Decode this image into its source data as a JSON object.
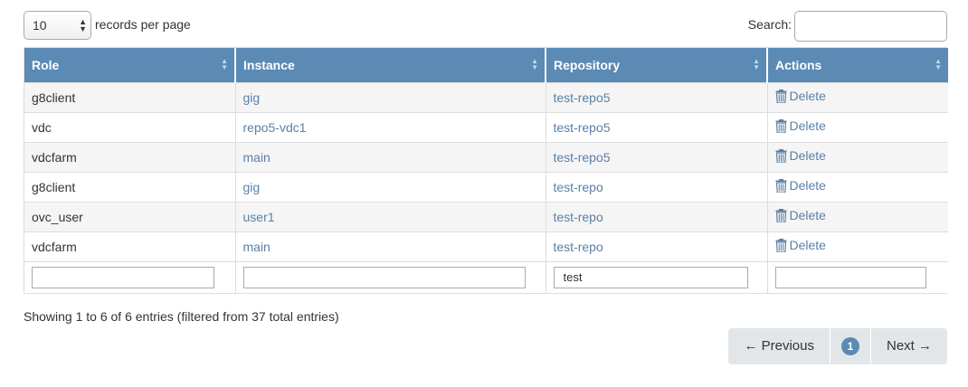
{
  "length_menu": {
    "value": "10",
    "label": "records per page"
  },
  "search": {
    "label": "Search:",
    "value": ""
  },
  "columns": [
    "Role",
    "Instance",
    "Repository",
    "Actions"
  ],
  "rows": [
    {
      "role": "g8client",
      "instance": "gig",
      "repository": "test-repo5",
      "action": "Delete"
    },
    {
      "role": "vdc",
      "instance": "repo5-vdc1",
      "repository": "test-repo5",
      "action": "Delete"
    },
    {
      "role": "vdcfarm",
      "instance": "main",
      "repository": "test-repo5",
      "action": "Delete"
    },
    {
      "role": "g8client",
      "instance": "gig",
      "repository": "test-repo",
      "action": "Delete"
    },
    {
      "role": "ovc_user",
      "instance": "user1",
      "repository": "test-repo",
      "action": "Delete"
    },
    {
      "role": "vdcfarm",
      "instance": "main",
      "repository": "test-repo",
      "action": "Delete"
    }
  ],
  "filters": {
    "role": "",
    "instance": "",
    "repository": "test",
    "actions": ""
  },
  "info": "Showing 1 to 6 of 6 entries (filtered from 37 total entries)",
  "pagination": {
    "previous": "← Previous",
    "current": "1",
    "next": "Next →"
  },
  "colors": {
    "header": "#5b8ab5",
    "link": "#5b7fa8",
    "pagination_bg": "#e3e6e9"
  },
  "icons": {
    "delete": "trash-icon",
    "sort": "sort-both-icon",
    "select": "select-arrows-icon"
  }
}
